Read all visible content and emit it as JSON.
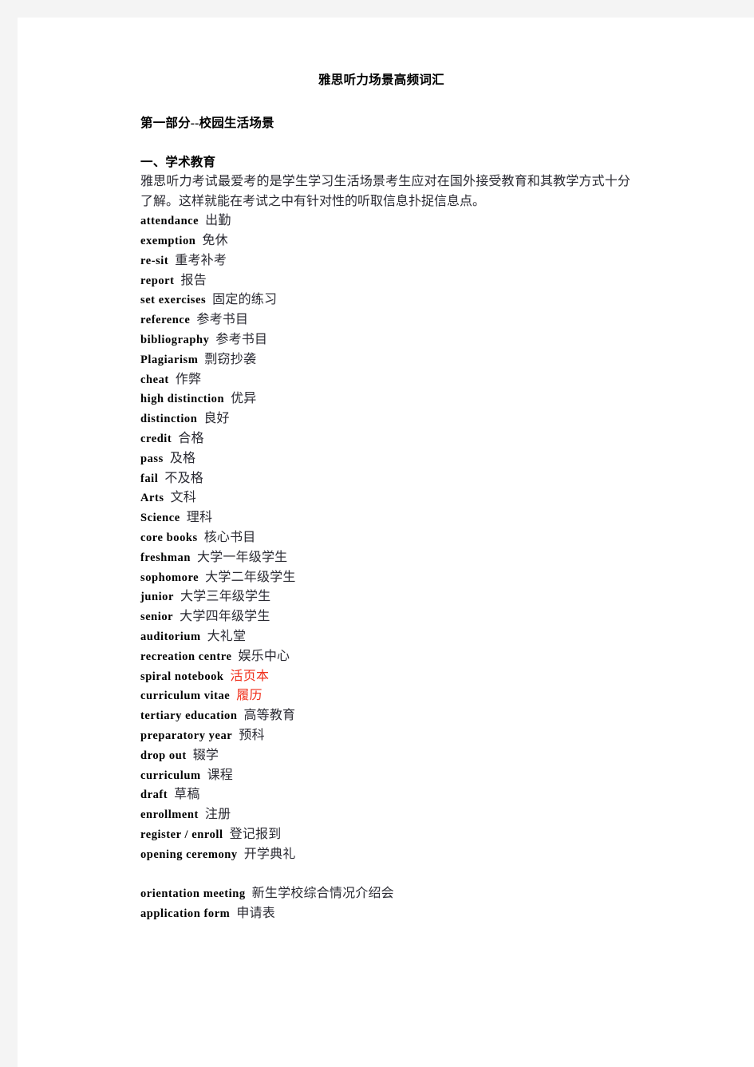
{
  "document": {
    "title": "雅思听力场景高频词汇",
    "section_heading": "第一部分--校园生活场景",
    "subsection_heading": "一、学术教育",
    "intro_paragraph": "雅思听力考试最爱考的是学生学习生活场景考生应对在国外接受教育和其教学方式十分了解。这样就能在考试之中有针对性的听取信息扑捉信息点。"
  },
  "colors": {
    "page_background": "#ffffff",
    "outer_background": "#f4f4f4",
    "text": "#000000",
    "gloss_text": "#2b2b33",
    "accent_red": "#f0301c"
  },
  "vocabulary": [
    {
      "term": "attendance",
      "gloss": "出勤",
      "color": "default"
    },
    {
      "term": "exemption",
      "gloss": "免休",
      "color": "default"
    },
    {
      "term": "re-sit",
      "gloss": "重考补考",
      "color": "default"
    },
    {
      "term": "report",
      "gloss": "报告",
      "color": "default"
    },
    {
      "term": "set  exercises",
      "gloss": "固定的练习",
      "color": "default"
    },
    {
      "term": "reference",
      "gloss": "参考书目",
      "color": "default"
    },
    {
      "term": "bibliography",
      "gloss": "参考书目",
      "color": "default"
    },
    {
      "term": "Plagiarism",
      "gloss": "剽窃抄袭",
      "color": "default"
    },
    {
      "term": "cheat",
      "gloss": "作弊",
      "color": "default"
    },
    {
      "term": "high  distinction",
      "gloss": "优异",
      "color": "default"
    },
    {
      "term": "distinction",
      "gloss": "良好",
      "color": "default"
    },
    {
      "term": "credit",
      "gloss": "合格",
      "color": "default"
    },
    {
      "term": "pass",
      "gloss": "及格",
      "color": "default"
    },
    {
      "term": "fail",
      "gloss": "不及格",
      "color": "default"
    },
    {
      "term": "Arts",
      "gloss": "文科",
      "color": "default"
    },
    {
      "term": "Science",
      "gloss": "理科",
      "color": "default"
    },
    {
      "term": "core  books",
      "gloss": "核心书目",
      "color": "default"
    },
    {
      "term": "freshman",
      "gloss": "大学一年级学生",
      "color": "default"
    },
    {
      "term": "sophomore",
      "gloss": "大学二年级学生",
      "color": "default"
    },
    {
      "term": "junior",
      "gloss": "大学三年级学生",
      "color": "default"
    },
    {
      "term": "senior",
      "gloss": "大学四年级学生",
      "color": "default"
    },
    {
      "term": "auditorium",
      "gloss": "大礼堂",
      "color": "default"
    },
    {
      "term": "recreation  centre",
      "gloss": "娱乐中心",
      "color": "default"
    },
    {
      "term": "spiral  notebook",
      "gloss": "活页本",
      "color": "red"
    },
    {
      "term": "curriculum  vitae",
      "gloss": "履历",
      "color": "red"
    },
    {
      "term": "tertiary  education",
      "gloss": "高等教育",
      "color": "default"
    },
    {
      "term": "preparatory  year",
      "gloss": "预科",
      "color": "default"
    },
    {
      "term": "drop  out",
      "gloss": "辍学",
      "color": "default"
    },
    {
      "term": "curriculum",
      "gloss": "课程",
      "color": "default"
    },
    {
      "term": "draft",
      "gloss": "草稿",
      "color": "default"
    },
    {
      "term": "enrollment",
      "gloss": "注册",
      "color": "default"
    },
    {
      "term": "register  /  enroll",
      "gloss": "登记报到",
      "color": "default"
    },
    {
      "term": "opening  ceremony",
      "gloss": "开学典礼",
      "color": "default"
    },
    {
      "term": "",
      "gloss": "",
      "color": "default"
    },
    {
      "term": "orientation  meeting",
      "gloss": "新生学校综合情况介绍会",
      "color": "default"
    },
    {
      "term": "application  form",
      "gloss": "申请表",
      "color": "default"
    }
  ]
}
